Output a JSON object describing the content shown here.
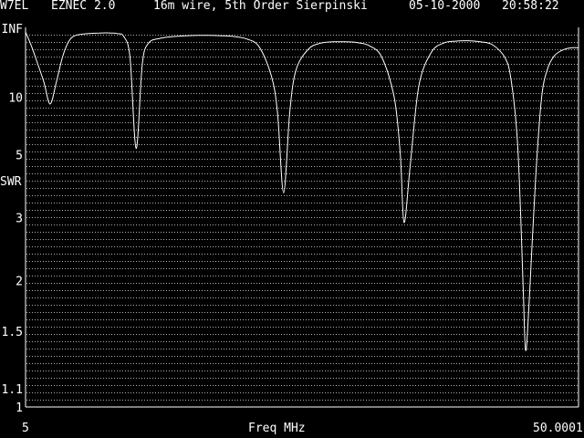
{
  "header": {
    "call": "W7EL",
    "program": "EZNEC 2.0",
    "title": "16m wire, 5th Order Sierpinski",
    "date": "05-10-2000",
    "time": "20:58:22"
  },
  "colors": {
    "background": "#000000",
    "foreground": "#ffffff",
    "grid": "#b0b0b0"
  },
  "chart_data": {
    "type": "line",
    "title": "16m wire, 5th Order Sierpinski",
    "xlabel": "Freq MHz",
    "ylabel": "SWR",
    "xlim": [
      5,
      50.0001
    ],
    "x_tick_labels": [
      "5",
      "50.0001"
    ],
    "y_scale": "swr-reflection (rho = (SWR-1)/(SWR+1)), INF at top",
    "y_tick_labels": [
      "INF",
      "10",
      "5",
      "3",
      "2",
      "1.5",
      "1.1",
      "1"
    ],
    "y_ticks": [
      1000000,
      10,
      5,
      3,
      2,
      1.5,
      1.1,
      1
    ],
    "grid": "dotted horizontal lines",
    "series": [
      {
        "points": [
          [
            5.0,
            200
          ],
          [
            5.5,
            40
          ],
          [
            6.0,
            20
          ],
          [
            6.5,
            13
          ],
          [
            7.0,
            9.0
          ],
          [
            7.5,
            13
          ],
          [
            8.0,
            25
          ],
          [
            8.5,
            55
          ],
          [
            9.0,
            100
          ],
          [
            10.0,
            140
          ],
          [
            11.0,
            160
          ],
          [
            12.0,
            160
          ],
          [
            12.5,
            140
          ],
          [
            13.0,
            90
          ],
          [
            13.5,
            25
          ],
          [
            14.0,
            5.3
          ],
          [
            14.5,
            20
          ],
          [
            15.0,
            50
          ],
          [
            16.0,
            75
          ],
          [
            17.0,
            90
          ],
          [
            18.0,
            100
          ],
          [
            19.0,
            105
          ],
          [
            20.0,
            105
          ],
          [
            21.0,
            100
          ],
          [
            22.0,
            90
          ],
          [
            23.0,
            70
          ],
          [
            24.0,
            40
          ],
          [
            25.0,
            15
          ],
          [
            25.5,
            8
          ],
          [
            26.0,
            3.6
          ],
          [
            26.5,
            8
          ],
          [
            27.0,
            17
          ],
          [
            28.0,
            35
          ],
          [
            29.0,
            50
          ],
          [
            30.0,
            55
          ],
          [
            31.0,
            55
          ],
          [
            32.0,
            52
          ],
          [
            33.0,
            42
          ],
          [
            34.0,
            25
          ],
          [
            35.0,
            10
          ],
          [
            35.5,
            5
          ],
          [
            35.8,
            2.9
          ],
          [
            36.3,
            4.5
          ],
          [
            37.0,
            12
          ],
          [
            38.0,
            30
          ],
          [
            39.0,
            50
          ],
          [
            40.0,
            58
          ],
          [
            41.0,
            60
          ],
          [
            42.0,
            55
          ],
          [
            43.0,
            45
          ],
          [
            44.0,
            25
          ],
          [
            44.5,
            14
          ],
          [
            45.0,
            6
          ],
          [
            45.3,
            3
          ],
          [
            45.5,
            1.9
          ],
          [
            45.7,
            1.35
          ],
          [
            46.0,
            1.8
          ],
          [
            46.5,
            4
          ],
          [
            47.0,
            10
          ],
          [
            47.5,
            18
          ],
          [
            48.0,
            26
          ],
          [
            48.5,
            32
          ],
          [
            49.0,
            36
          ],
          [
            49.5,
            38
          ],
          [
            50.0001,
            38
          ]
        ]
      }
    ]
  }
}
